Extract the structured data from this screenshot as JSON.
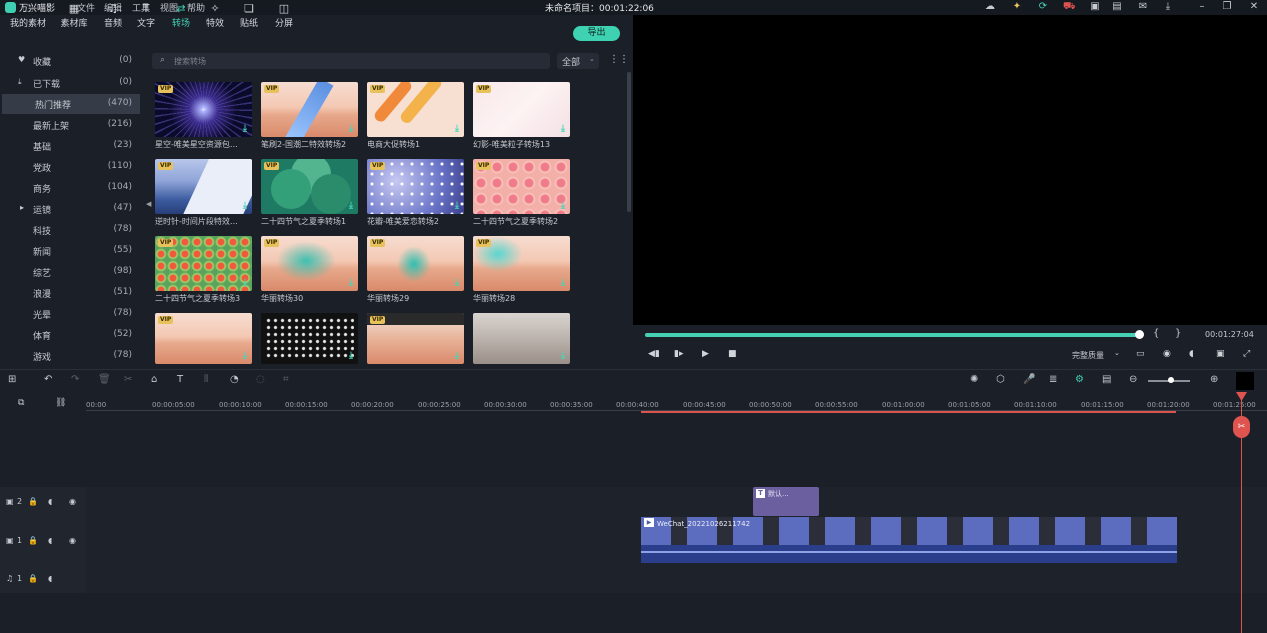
{
  "app": {
    "name": "万兴喵影",
    "menus": [
      "文件",
      "编辑",
      "工具",
      "视图",
      "帮助"
    ],
    "project_title": "未命名项目：00:01:22:06"
  },
  "titlebar_icons": [
    "cloud-icon",
    "bulb-icon",
    "sync-icon",
    "cart-icon",
    "gift-icon",
    "save-icon",
    "mail-icon",
    "download-icon",
    "minimize-icon",
    "restore-icon",
    "close-icon"
  ],
  "tabs": [
    {
      "label": "我的素材",
      "icon": "folder-icon"
    },
    {
      "label": "素材库",
      "icon": "media-library-icon"
    },
    {
      "label": "音频",
      "icon": "music-icon"
    },
    {
      "label": "文字",
      "icon": "text-icon"
    },
    {
      "label": "转场",
      "icon": "transition-icon",
      "active": true
    },
    {
      "label": "特效",
      "icon": "effects-icon"
    },
    {
      "label": "贴纸",
      "icon": "sticker-icon"
    },
    {
      "label": "分屏",
      "icon": "split-screen-icon"
    }
  ],
  "export_label": "导出",
  "sidebar": {
    "items": [
      {
        "label": "收藏",
        "count": "(0)"
      },
      {
        "label": "已下载",
        "count": "(0)"
      },
      {
        "label": "热门推荐",
        "count": "(470)",
        "selected": true
      },
      {
        "label": "最新上架",
        "count": "(216)"
      },
      {
        "label": "基础",
        "count": "(23)"
      },
      {
        "label": "党政",
        "count": "(110)"
      },
      {
        "label": "商务",
        "count": "(104)"
      },
      {
        "label": "运镜",
        "count": "(47)",
        "expandable": true
      },
      {
        "label": "科技",
        "count": "(78)"
      },
      {
        "label": "新闻",
        "count": "(55)"
      },
      {
        "label": "综艺",
        "count": "(98)"
      },
      {
        "label": "浪漫",
        "count": "(51)"
      },
      {
        "label": "光晕",
        "count": "(78)"
      },
      {
        "label": "体育",
        "count": "(52)"
      },
      {
        "label": "游戏",
        "count": "(78)"
      }
    ]
  },
  "search": {
    "placeholder": "搜索转场",
    "value": ""
  },
  "filter": {
    "selected": "全部"
  },
  "transitions": [
    {
      "name": "星空-唯美星空资源包…",
      "vip": true,
      "style": "t-starfield"
    },
    {
      "name": "笔刷2-国潮二特效转场2",
      "vip": true,
      "style": "t-desert-stroke"
    },
    {
      "name": "电商大促转场1",
      "vip": true,
      "style": "t-promo"
    },
    {
      "name": "幻影-唯美粒子转场13",
      "vip": true,
      "style": "t-whitewave"
    },
    {
      "name": "逆时针-时间片段特效…",
      "vip": true,
      "style": "t-mountain"
    },
    {
      "name": "二十四节气之夏季转场1",
      "vip": true,
      "style": "t-green"
    },
    {
      "name": "花瓣-唯美爱恋转场2",
      "vip": true,
      "style": "t-flowers-blue"
    },
    {
      "name": "二十四节气之夏季转场2",
      "vip": true,
      "style": "t-flowers-pink"
    },
    {
      "name": "二十四节气之夏季转场3",
      "vip": true,
      "style": "t-green-flowers"
    },
    {
      "name": "华丽转场30",
      "vip": true,
      "style": "t-teal-smoke"
    },
    {
      "name": "华丽转场29",
      "vip": true,
      "style": "t-teal-blob"
    },
    {
      "name": "华丽转场28",
      "vip": true,
      "style": "t-teal-cloud"
    },
    {
      "name": "",
      "vip": true,
      "style": "t-desert"
    },
    {
      "name": "",
      "vip": false,
      "style": "t-dots"
    },
    {
      "name": "",
      "vip": true,
      "style": "t-glitch"
    },
    {
      "name": "",
      "vip": false,
      "style": "t-gray"
    }
  ],
  "vip_label": "VIP",
  "download_glyph": "⤓",
  "preview": {
    "time": "00:01:27:04",
    "progress": 0.995,
    "quality": "完整质量"
  },
  "ruler": [
    "00:00",
    "00:00:05:00",
    "00:00:10:00",
    "00:00:15:00",
    "00:00:20:00",
    "00:00:25:00",
    "00:00:30:00",
    "00:00:35:00",
    "00:00:40:00",
    "00:00:45:00",
    "00:00:50:00",
    "00:00:55:00",
    "00:01:00:00",
    "00:01:05:00",
    "00:01:10:00",
    "00:01:15:00",
    "00:01:20:00",
    "00:01:25:00"
  ],
  "tracks": [
    {
      "num": "2",
      "type": "video"
    },
    {
      "num": "1",
      "type": "video"
    },
    {
      "num": "1",
      "type": "audio"
    }
  ],
  "clips": {
    "title_label": "默认...",
    "video_label": "WeChat_20221026211742"
  }
}
